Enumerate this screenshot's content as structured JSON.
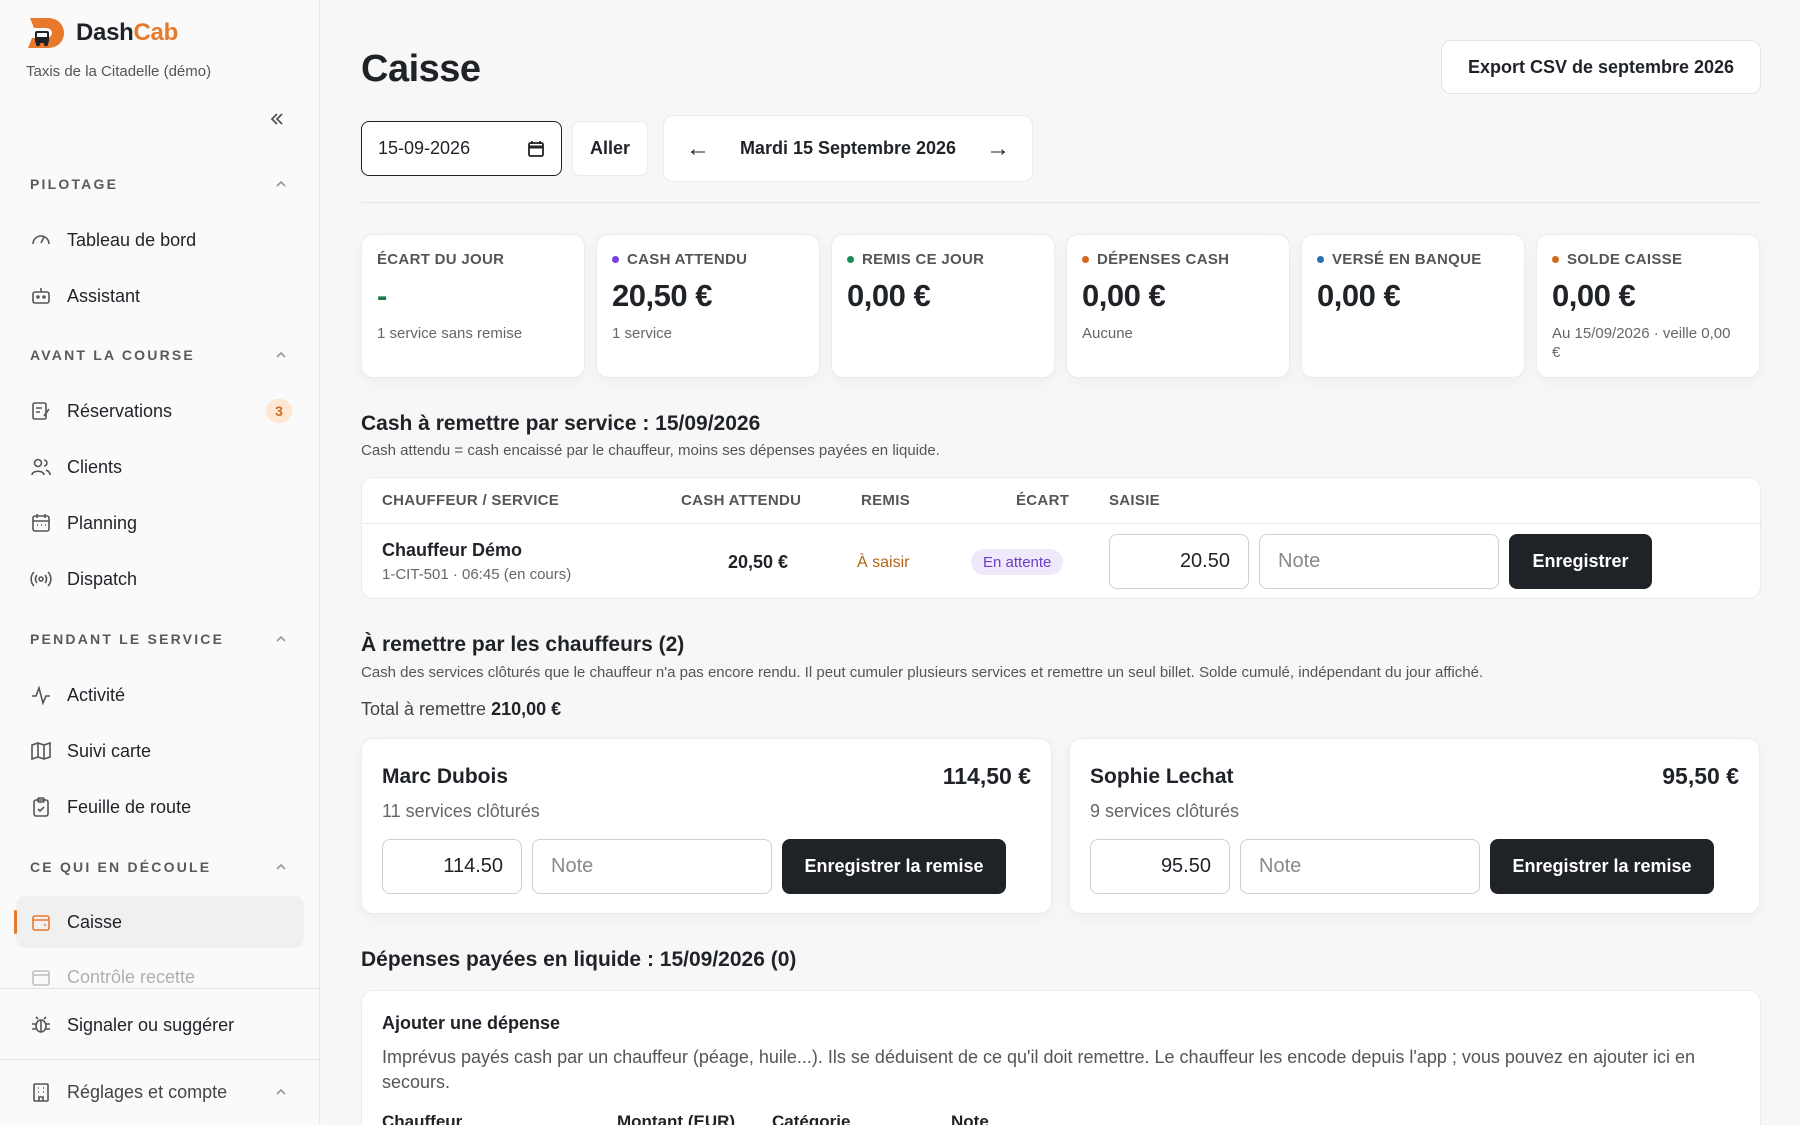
{
  "brand": {
    "name_a": "Dash",
    "name_b": "Cab",
    "org": "Taxis de la Citadelle (démo)"
  },
  "sidebar": {
    "sections": [
      {
        "title": "PILOTAGE"
      },
      {
        "title": "AVANT LA COURSE"
      },
      {
        "title": "PENDANT LE SERVICE"
      },
      {
        "title": "CE QUI EN DÉCOULE"
      }
    ],
    "items": {
      "dashboard": "Tableau de bord",
      "assistant": "Assistant",
      "reservations": "Réservations",
      "reservations_badge": "3",
      "clients": "Clients",
      "planning": "Planning",
      "dispatch": "Dispatch",
      "activity": "Activité",
      "map": "Suivi carte",
      "roadsheet": "Feuille de route",
      "cashbox": "Caisse",
      "revenue_check": "Contrôle recette",
      "report": "Signaler ou suggérer",
      "settings": "Réglages et compte"
    }
  },
  "page": {
    "title": "Caisse",
    "export_label": "Export CSV de septembre 2026",
    "date_value": "15-09-2026",
    "go_label": "Aller",
    "day_label": "Mardi 15 Septembre 2026",
    "prev_arrow": "←",
    "next_arrow": "→"
  },
  "kpis": [
    {
      "label": "ÉCART DU JOUR",
      "value": "-",
      "sub": "1 service sans remise",
      "color": ""
    },
    {
      "label": "CASH ATTENDU",
      "value": "20,50 €",
      "sub": "1 service",
      "color": "#7b3fe4"
    },
    {
      "label": "REMIS CE JOUR",
      "value": "0,00 €",
      "sub": "",
      "color": "#1a8a5a"
    },
    {
      "label": "DÉPENSES CASH",
      "value": "0,00 €",
      "sub": "Aucune",
      "color": "#d2691e"
    },
    {
      "label": "VERSÉ EN BANQUE",
      "value": "0,00 €",
      "sub": "",
      "color": "#2a6fb0"
    },
    {
      "label": "SOLDE CAISSE",
      "value": "0,00 €",
      "sub": "Au 15/09/2026 · veille 0,00 €",
      "color": "#d2691e"
    }
  ],
  "service_section": {
    "title": "Cash à remettre par service : 15/09/2026",
    "subtitle": "Cash attendu = cash encaissé par le chauffeur, moins ses dépenses payées en liquide.",
    "headers": {
      "driver": "CHAUFFEUR / SERVICE",
      "expected": "CASH ATTENDU",
      "remitted": "REMIS",
      "gap": "ÉCART",
      "entry": "SAISIE"
    },
    "row": {
      "driver": "Chauffeur Démo",
      "meta": "1-CIT-501 · 06:45 (en cours)",
      "expected": "20,50 €",
      "remitted": "À saisir",
      "gap": "En attente",
      "amount": "20.50",
      "note_placeholder": "Note",
      "save_label": "Enregistrer"
    }
  },
  "drivers_section": {
    "title": "À remettre par les chauffeurs (2)",
    "subtitle": "Cash des services clôturés que le chauffeur n'a pas encore rendu. Il peut cumuler plusieurs services et remettre un seul billet. Solde cumulé, indépendant du jour affiché.",
    "total_label": "Total à remettre",
    "total_value": "210,00 €",
    "cards": [
      {
        "name": "Marc Dubois",
        "amount": "114,50 €",
        "services": "11 services clôturés",
        "input": "114.50",
        "note": "Note",
        "button": "Enregistrer la remise"
      },
      {
        "name": "Sophie Lechat",
        "amount": "95,50 €",
        "services": "9 services clôturés",
        "input": "95.50",
        "note": "Note",
        "button": "Enregistrer la remise"
      }
    ]
  },
  "expenses_section": {
    "title": "Dépenses payées en liquide : 15/09/2026 (0)",
    "add_title": "Ajouter une dépense",
    "add_desc": "Imprévus payés cash par un chauffeur (péage, huile...). Ils se déduisent de ce qu'il doit remettre. Le chauffeur les encode depuis l'app ; vous pouvez en ajouter ici en secours.",
    "columns": {
      "driver": "Chauffeur",
      "amount": "Montant (EUR)",
      "category": "Catégorie",
      "note": "Note"
    }
  }
}
